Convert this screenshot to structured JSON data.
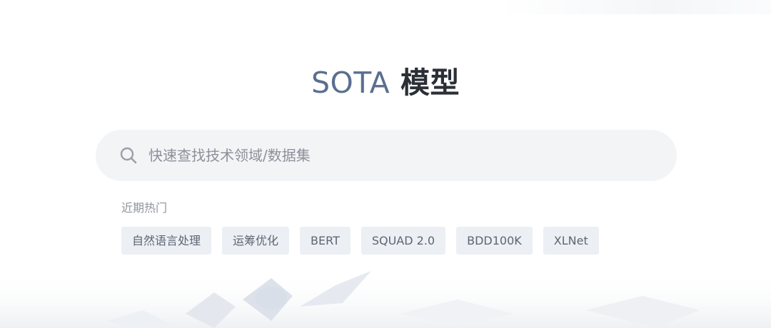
{
  "hero": {
    "title_accent": "SOTA",
    "title_rest": "模型"
  },
  "search": {
    "placeholder": "快速查找技术领域/数据集",
    "value": "",
    "icon": "search-icon"
  },
  "hot": {
    "label": "近期热门",
    "tags": [
      "自然语言处理",
      "运筹优化",
      "BERT",
      "SQUAD 2.0",
      "BDD100K",
      "XLNet"
    ]
  },
  "colors": {
    "accent": "#5a6f8f",
    "title": "#2b2f36",
    "search_bg": "#f3f4f6",
    "tag_bg": "#eceff4",
    "tag_text": "#5e6572",
    "muted": "#8f949c"
  }
}
